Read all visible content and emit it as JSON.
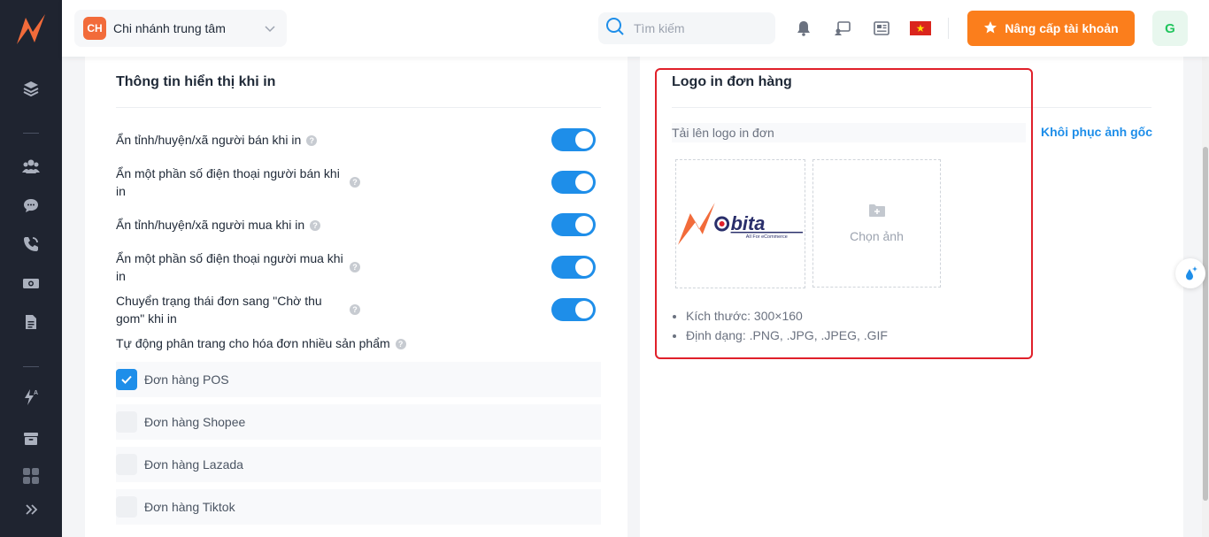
{
  "sidebar": {
    "icons": [
      "app-logo-icon",
      "layers-icon",
      "users-icon",
      "chat-icon",
      "phone-icon",
      "money-icon",
      "document-icon",
      "flash-ads-icon",
      "archive-icon",
      "apps-grid-icon",
      "expand-icon"
    ]
  },
  "header": {
    "branch_initials": "CH",
    "branch_name": "Chi nhánh trung tâm",
    "search_placeholder": "Tìm kiếm",
    "upgrade_label": "Nâng cấp tài khoản",
    "user_initial": "G",
    "colors": {
      "accent": "#fb7e1c",
      "branch_avatar": "#f26b3a"
    }
  },
  "print_settings": {
    "title": "Thông tin hiển thị khi in",
    "toggles": [
      {
        "label": "Ẩn tỉnh/huyện/xã người bán khi in",
        "on": true
      },
      {
        "label": "Ẩn một phần số điện thoại người bán khi in",
        "on": true
      },
      {
        "label": "Ẩn tỉnh/huyện/xã người mua khi in",
        "on": true
      },
      {
        "label": "Ẩn một phần số điện thoại người mua khi in",
        "on": true
      },
      {
        "label": "Chuyển trạng thái đơn sang \"Chờ thu gom\" khi in",
        "on": true
      }
    ],
    "auto_paging_label": "Tự động phân trang cho hóa đơn nhiều sản phẩm",
    "checkboxes": [
      {
        "label": "Đơn hàng POS",
        "checked": true
      },
      {
        "label": "Đơn hàng Shopee",
        "checked": false
      },
      {
        "label": "Đơn hàng Lazada",
        "checked": false
      },
      {
        "label": "Đơn hàng Tiktok",
        "checked": false
      }
    ],
    "toggle_color": "#1e8ee9"
  },
  "logo_settings": {
    "title": "Logo in đơn hàng",
    "upload_label": "Tải lên logo in đơn",
    "restore_label": "Khôi phục ảnh gốc",
    "logo_text": "bita",
    "logo_tagline": "All For eCommerce",
    "choose_label": "Chọn ảnh",
    "specs": [
      "Kích thước: 300×160",
      "Định dạng: .PNG, .JPG, .JPEG, .GIF"
    ],
    "highlight_color": "#e0202a"
  }
}
